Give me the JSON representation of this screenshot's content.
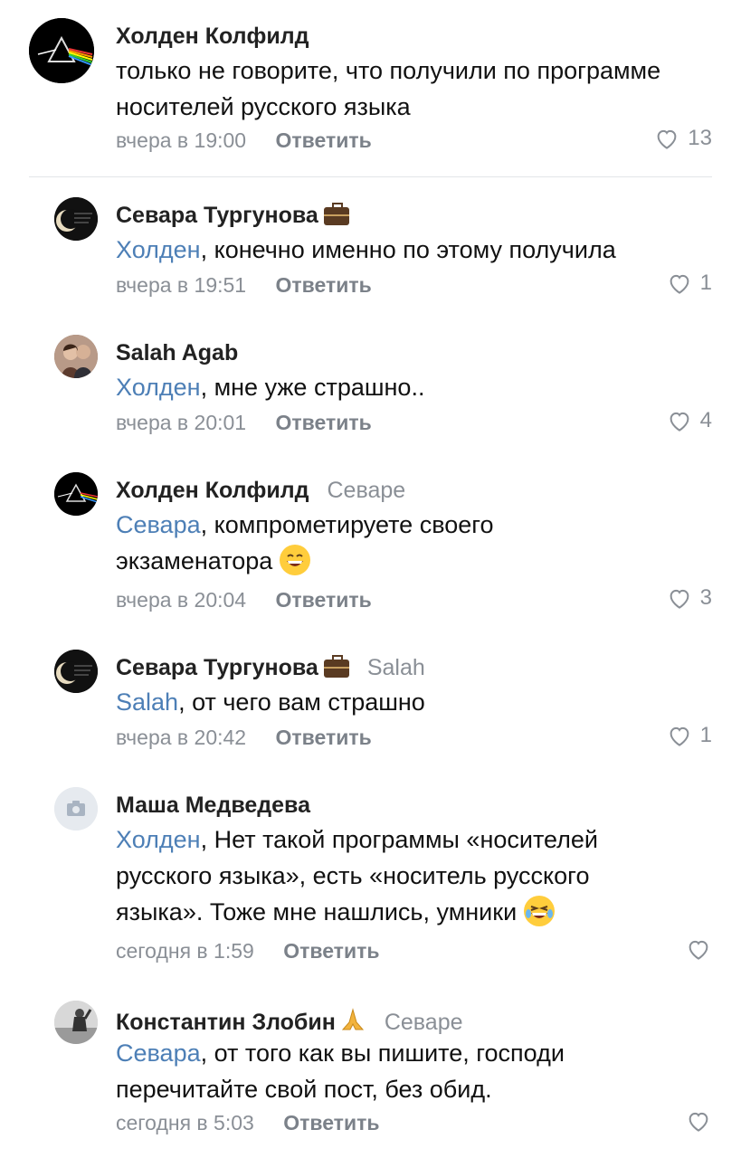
{
  "reply_label": "Ответить",
  "comments": [
    {
      "author": "Холден Колфилд",
      "reply_to": "",
      "mention": "",
      "text": "только не говорите, что получили по программе носителей русского языка",
      "time": "вчера в 19:00",
      "likes": "13"
    },
    {
      "author": "Севара Тургунова",
      "reply_to": "",
      "mention": "Холден",
      "text": ", конечно именно по этому получила",
      "time": "вчера в 19:51",
      "likes": "1"
    },
    {
      "author": "Salah Agab",
      "reply_to": "",
      "mention": "Холден",
      "text": ", мне уже страшно..",
      "time": "вчера в 20:01",
      "likes": "4"
    },
    {
      "author": "Холден Колфилд",
      "reply_to": "Севаре",
      "mention": "Севара",
      "text": ", компрометируете своего экзаменатора",
      "time": "вчера в 20:04",
      "likes": "3"
    },
    {
      "author": "Севара Тургунова",
      "reply_to": "Salah",
      "mention": "Salah",
      "text": ", от чего вам страшно",
      "time": "вчера в 20:42",
      "likes": "1"
    },
    {
      "author": "Маша Медведева",
      "reply_to": "",
      "mention": "Холден",
      "text": ", Нет такой программы «носителей русского языка», есть «носитель русского языка». Тоже мне нашлись, умники",
      "time": "сегодня в 1:59",
      "likes": ""
    },
    {
      "author": "Константин Злобин",
      "reply_to": "Севаре",
      "mention": "Севара",
      "text": ", от того как вы пишите, господи перечитайте свой пост, без обид.",
      "time": "сегодня в 5:03",
      "likes": ""
    }
  ],
  "colors": {
    "link": "#4d7fb6",
    "meta": "#8a8f96",
    "divider": "#e3e5e8"
  }
}
